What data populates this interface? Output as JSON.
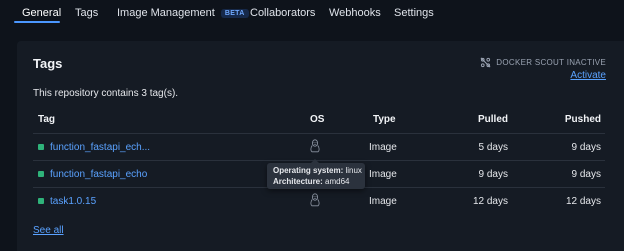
{
  "tabs": {
    "general": "General",
    "tags": "Tags",
    "image_management": "Image Management",
    "image_management_badge": "BETA",
    "collaborators": "Collaborators",
    "webhooks": "Webhooks",
    "settings": "Settings",
    "active": "General"
  },
  "card": {
    "title": "Tags",
    "scout_status": "DOCKER SCOUT INACTIVE",
    "activate_link": "Activate",
    "summary": "This repository contains 3 tag(s).",
    "see_all": "See all"
  },
  "table": {
    "headers": {
      "tag": "Tag",
      "os": "OS",
      "type": "Type",
      "pulled": "Pulled",
      "pushed": "Pushed"
    },
    "rows": [
      {
        "tag": "function_fastapi_ech...",
        "os_icon": "linux-icon",
        "type": "Image",
        "pulled": "5 days",
        "pushed": "9 days"
      },
      {
        "tag": "function_fastapi_echo",
        "os_icon": "linux-icon",
        "type": "Image",
        "pulled": "9 days",
        "pushed": "9 days"
      },
      {
        "tag": "task1.0.15",
        "os_icon": "linux-icon",
        "type": "Image",
        "pulled": "12 days",
        "pushed": "12 days"
      }
    ]
  },
  "tooltip": {
    "os_key": "Operating system:",
    "os_value": " linux",
    "arch_key": "Architecture:",
    "arch_value": " amd64"
  },
  "colors": {
    "accent": "#4b97ff",
    "link": "#5aa2ff",
    "status_dot": "#2fb37a",
    "background": "#0e131b",
    "card": "#151b24"
  }
}
